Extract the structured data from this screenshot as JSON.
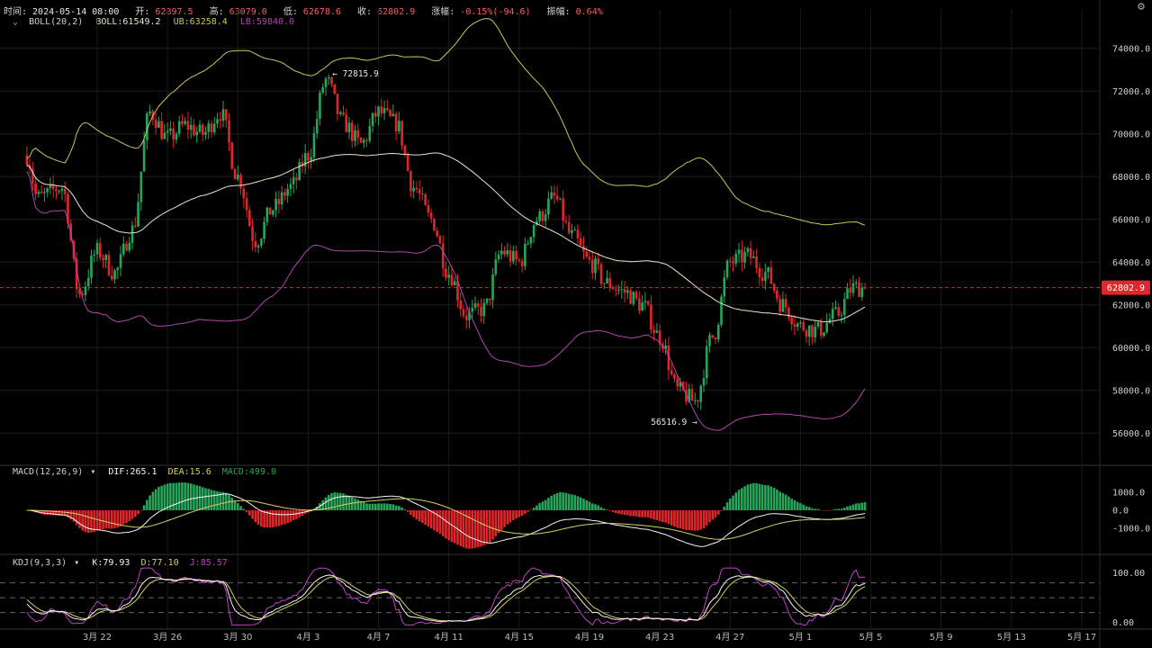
{
  "header": {
    "time_label": "时间:",
    "time": "2024-05-14 08:00",
    "open_label": "开:",
    "open": "62897.5",
    "high_label": "高:",
    "high": "63079.0",
    "low_label": "低:",
    "low": "62678.6",
    "close_label": "收:",
    "close": "62802.9",
    "change_label": "涨幅:",
    "change": "-0.15%(-94.6)",
    "amp_label": "振幅:",
    "amp": "0.64%"
  },
  "indicators": {
    "boll": {
      "caret": "⌄",
      "name": "BOLL(20,2)",
      "mid": "BOLL:61549.2",
      "ub": "UB:63258.4",
      "lb": "LB:59840.0"
    },
    "macd": {
      "name": "MACD(12,26,9)",
      "caret": "▾",
      "dif": "DIF:265.1",
      "dea": "DEA:15.6",
      "macd": "MACD:499.0"
    },
    "kdj": {
      "name": "KDJ(9,3,3)",
      "caret": "▾",
      "k": "K:79.93",
      "d": "D:77.10",
      "j": "J:85.57"
    }
  },
  "colors": {
    "up": "#26a65b",
    "down": "#e0262a",
    "mid": "#e6e6c8",
    "ub": "#c9c65a",
    "lb": "#b244b0",
    "dif": "#f4f4f4",
    "dea": "#d8cf60",
    "k": "#f4f4f4",
    "d": "#d8cf60",
    "j": "#c23fc8",
    "price_tag": "#e0262a"
  },
  "chart_data": {
    "type": "candlestick",
    "x_ticks": [
      "3月 22",
      "3月 26",
      "3月 30",
      "4月 3",
      "4月 7",
      "4月 11",
      "4月 15",
      "4月 19",
      "4月 23",
      "4月 27",
      "5月 1",
      "5月 5",
      "5月 9",
      "5月 13",
      "5月 17"
    ],
    "price_axis": {
      "ticks": [
        "74000.0",
        "72000.0",
        "70000.0",
        "68000.0",
        "66000.0",
        "64000.0",
        "62000.0",
        "60000.0",
        "58000.0",
        "56000.0"
      ],
      "range": [
        55000,
        75000
      ]
    },
    "macd_axis": {
      "ticks": [
        "1000.0",
        "0.0",
        "-1000.0"
      ],
      "range": [
        -1900,
        1500
      ]
    },
    "kdj_axis": {
      "ticks": [
        "100.00",
        "0.00"
      ],
      "range": [
        -8,
        112
      ],
      "dashed": [
        80,
        50,
        20
      ]
    },
    "last_price": "62802.9",
    "annotations": [
      {
        "text": "← 72815.9",
        "value": 72815.9
      },
      {
        "text": "56516.9 →",
        "value": 56516.9
      }
    ],
    "close_keypoints": [
      [
        0,
        69000
      ],
      [
        0.6,
        67000
      ],
      [
        2,
        67500
      ],
      [
        3,
        62500
      ],
      [
        4,
        64500
      ],
      [
        5,
        63500
      ],
      [
        6,
        65500
      ],
      [
        7,
        71000
      ],
      [
        8,
        69800
      ],
      [
        9,
        70400
      ],
      [
        10,
        70000
      ],
      [
        11,
        71000
      ],
      [
        12,
        68000
      ],
      [
        13,
        65000
      ],
      [
        14,
        66500
      ],
      [
        15,
        67500
      ],
      [
        16,
        69000
      ],
      [
        17,
        72500
      ],
      [
        18,
        70500
      ],
      [
        19,
        69500
      ],
      [
        20,
        71000
      ],
      [
        21,
        70500
      ],
      [
        22,
        67500
      ],
      [
        23,
        66000
      ],
      [
        24,
        63500
      ],
      [
        25,
        61500
      ],
      [
        26,
        61800
      ],
      [
        27,
        64500
      ],
      [
        28,
        64000
      ],
      [
        29,
        66000
      ],
      [
        30,
        67000
      ],
      [
        31,
        65200
      ],
      [
        32,
        64000
      ],
      [
        33,
        63000
      ],
      [
        34,
        62600
      ],
      [
        35,
        62000
      ],
      [
        36,
        60500
      ],
      [
        37,
        58000
      ],
      [
        38,
        57500
      ],
      [
        39,
        60500
      ],
      [
        40,
        64000
      ],
      [
        41,
        64300
      ],
      [
        42,
        63500
      ],
      [
        43,
        62000
      ],
      [
        44,
        61000
      ],
      [
        45,
        60800
      ],
      [
        46,
        61500
      ],
      [
        47,
        62800
      ]
    ]
  }
}
